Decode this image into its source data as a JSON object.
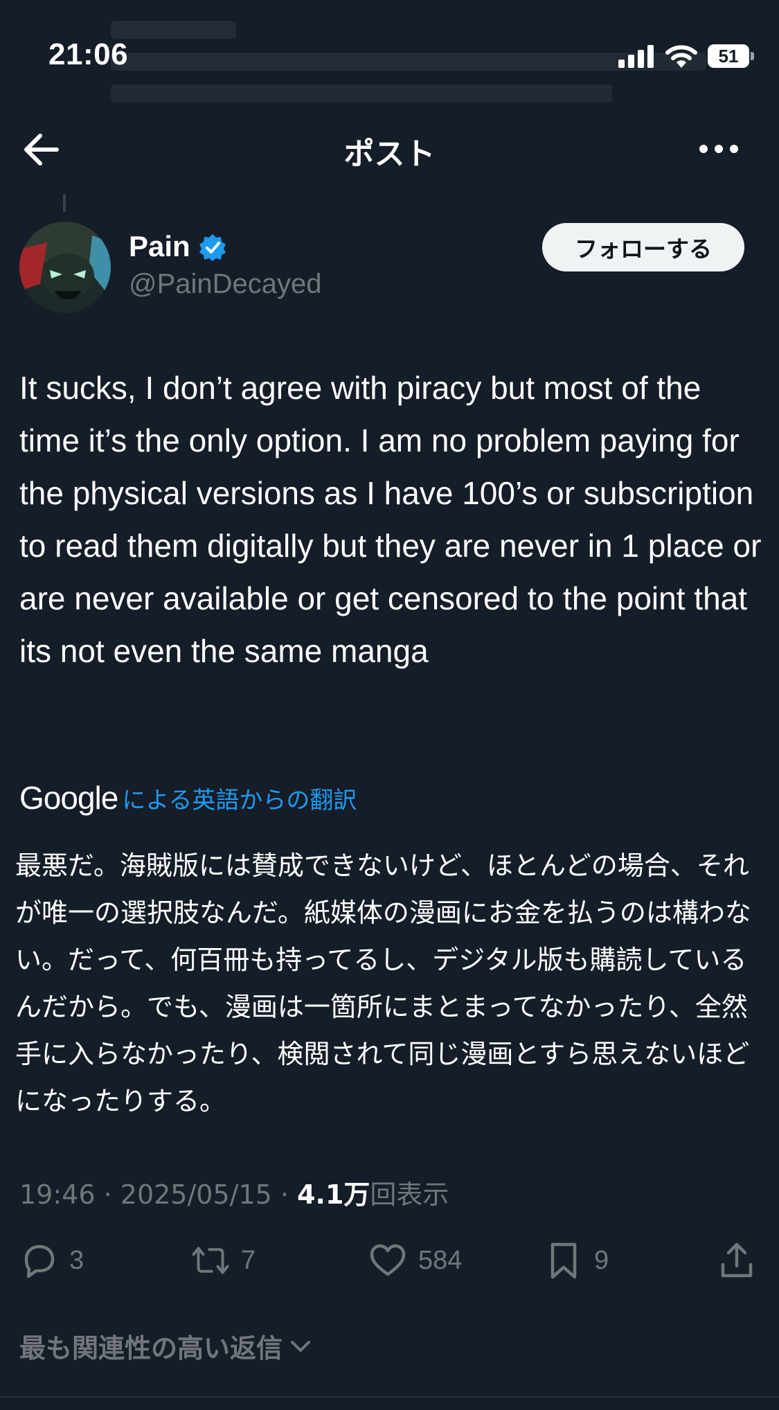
{
  "status_bar": {
    "time": "21:06",
    "battery": "51"
  },
  "header": {
    "title": "ポスト"
  },
  "author": {
    "name": "Pain",
    "handle": "@PainDecayed",
    "follow_label": "フォローする"
  },
  "post": {
    "text": "It sucks, I don’t agree with piracy but most of the time it’s the only option. I am no problem paying for the physical versions as I have 100’s or subscription to read them digitally but they are never in 1 place or are never available or get censored to the point that its not even the same manga"
  },
  "translation": {
    "provider": "Google",
    "label": "による英語からの翻訳",
    "text": "最悪だ。海賊版には賛成できないけど、ほとんどの場合、それが唯一の選択肢なんだ。紙媒体の漫画にお金を払うのは構わない。だって、何百冊も持ってるし、デジタル版も購読しているんだから。でも、漫画は一箇所にまとまってなかったり、全然手に入らなかったり、検閲されて同じ漫画とすら思えないほどになったりする。"
  },
  "meta": {
    "time": "19:46",
    "date": "2025/05/15",
    "views": "4.1万",
    "views_label": "回表示"
  },
  "actions": {
    "replies": "3",
    "reposts": "7",
    "likes": "584",
    "bookmarks": "9"
  },
  "replies": {
    "sort_label": "最も関連性の高い返信"
  },
  "colors": {
    "background": "#151d28",
    "accent": "#1d9bf0",
    "muted": "#71767b",
    "text": "#ffffff"
  }
}
